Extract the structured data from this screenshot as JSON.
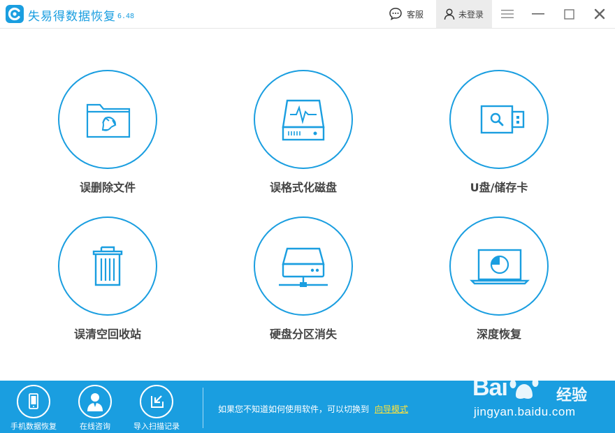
{
  "app": {
    "title": "失易得数据恢复",
    "version": "6.48",
    "brand_color": "#1a9ee0"
  },
  "titlebar": {
    "service_label": "客服",
    "service_icon": "chat-bubble-icon",
    "login_label": "未登录",
    "login_icon": "user-icon",
    "menu_icon": "hamburger-menu-icon",
    "minimize_icon": "minimize-icon",
    "maximize_icon": "maximize-icon",
    "close_icon": "close-icon"
  },
  "tiles": [
    {
      "label": "误删除文件",
      "icon": "folder-recycle-icon"
    },
    {
      "label": "误格式化磁盘",
      "icon": "hard-disk-pulse-icon"
    },
    {
      "label": "U盘/储存卡",
      "icon": "usb-drive-search-icon"
    },
    {
      "label": "误清空回收站",
      "icon": "trash-bin-icon"
    },
    {
      "label": "硬盘分区消失",
      "icon": "network-drive-icon"
    },
    {
      "label": "深度恢复",
      "icon": "laptop-disk-icon"
    }
  ],
  "bottombar": {
    "buttons": [
      {
        "label": "手机数据恢复",
        "icon": "phone-icon"
      },
      {
        "label": "在线咨询",
        "icon": "consultant-icon"
      },
      {
        "label": "导入扫描记录",
        "icon": "import-icon"
      }
    ],
    "hint_text": "如果您不知道如何使用软件，可以切换到",
    "hint_link": "向导模式",
    "link_color": "#ffe33a"
  },
  "watermark": {
    "brand": "Bai",
    "brand_suffix": "经验",
    "url": "jingyan.baidu.com"
  }
}
